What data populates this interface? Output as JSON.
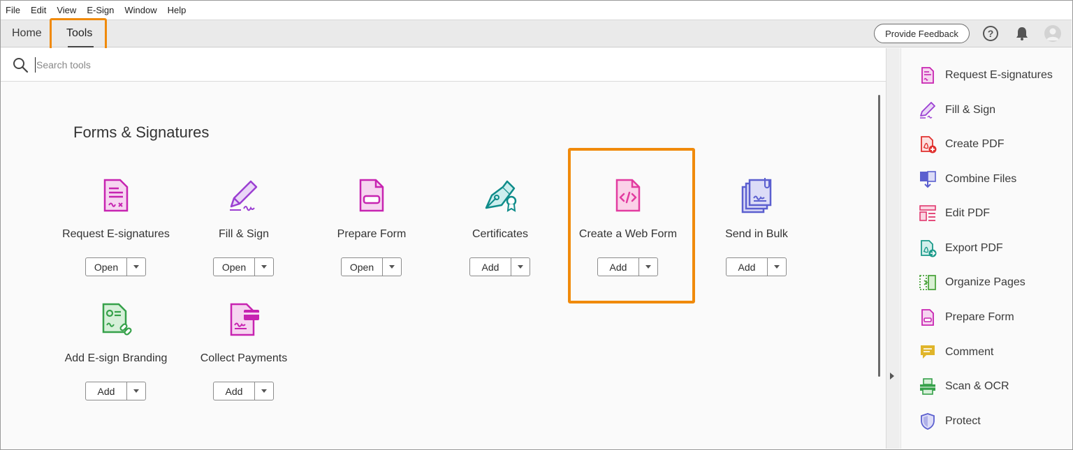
{
  "menu": {
    "items": [
      "File",
      "Edit",
      "View",
      "E-Sign",
      "Window",
      "Help"
    ]
  },
  "tabs": {
    "home": "Home",
    "tools": "Tools"
  },
  "header": {
    "feedback_label": "Provide Feedback",
    "help_icon": "question-circle-icon",
    "bell_icon": "bell-icon",
    "avatar_icon": "user-avatar-icon"
  },
  "search": {
    "placeholder": "Search tools",
    "value": ""
  },
  "section": {
    "title": "Forms & Signatures"
  },
  "tools": [
    {
      "label": "Request E-signatures",
      "button": "Open",
      "icon": "request-esignatures-icon",
      "color": "#c724b1"
    },
    {
      "label": "Fill & Sign",
      "button": "Open",
      "icon": "fill-sign-icon",
      "color": "#9b3fd2"
    },
    {
      "label": "Prepare Form",
      "button": "Open",
      "icon": "prepare-form-icon",
      "color": "#c724b1"
    },
    {
      "label": "Certificates",
      "button": "Add",
      "icon": "certificates-icon",
      "color": "#0f8c8a"
    },
    {
      "label": "Create a Web Form",
      "button": "Add",
      "icon": "web-form-icon",
      "color": "#e23ca0"
    },
    {
      "label": "Send in Bulk",
      "button": "Add",
      "icon": "send-in-bulk-icon",
      "color": "#5b5fcf"
    },
    {
      "label": "Add E-sign Branding",
      "button": "Add",
      "icon": "esign-branding-icon",
      "color": "#36a14a"
    },
    {
      "label": "Collect Payments",
      "button": "Add",
      "icon": "collect-payments-icon",
      "color": "#c724b1"
    }
  ],
  "rail": {
    "items": [
      {
        "label": "Request E-signatures",
        "icon": "request-esignatures-icon",
        "color": "#c724b1"
      },
      {
        "label": "Fill & Sign",
        "icon": "fill-sign-icon",
        "color": "#9b3fd2"
      },
      {
        "label": "Create PDF",
        "icon": "create-pdf-icon",
        "color": "#e0312f"
      },
      {
        "label": "Combine Files",
        "icon": "combine-files-icon",
        "color": "#5b5fcf"
      },
      {
        "label": "Edit PDF",
        "icon": "edit-pdf-icon",
        "color": "#e2396f"
      },
      {
        "label": "Export PDF",
        "icon": "export-pdf-icon",
        "color": "#1c9a8a"
      },
      {
        "label": "Organize Pages",
        "icon": "organize-pages-icon",
        "color": "#4ea53f"
      },
      {
        "label": "Prepare Form",
        "icon": "prepare-form-icon",
        "color": "#c724b1"
      },
      {
        "label": "Comment",
        "icon": "comment-icon",
        "color": "#e0b52a"
      },
      {
        "label": "Scan & OCR",
        "icon": "scan-ocr-icon",
        "color": "#36a14a"
      },
      {
        "label": "Protect",
        "icon": "protect-icon",
        "color": "#5b5fcf"
      }
    ]
  },
  "highlight": {
    "color": "#f08a0b"
  }
}
